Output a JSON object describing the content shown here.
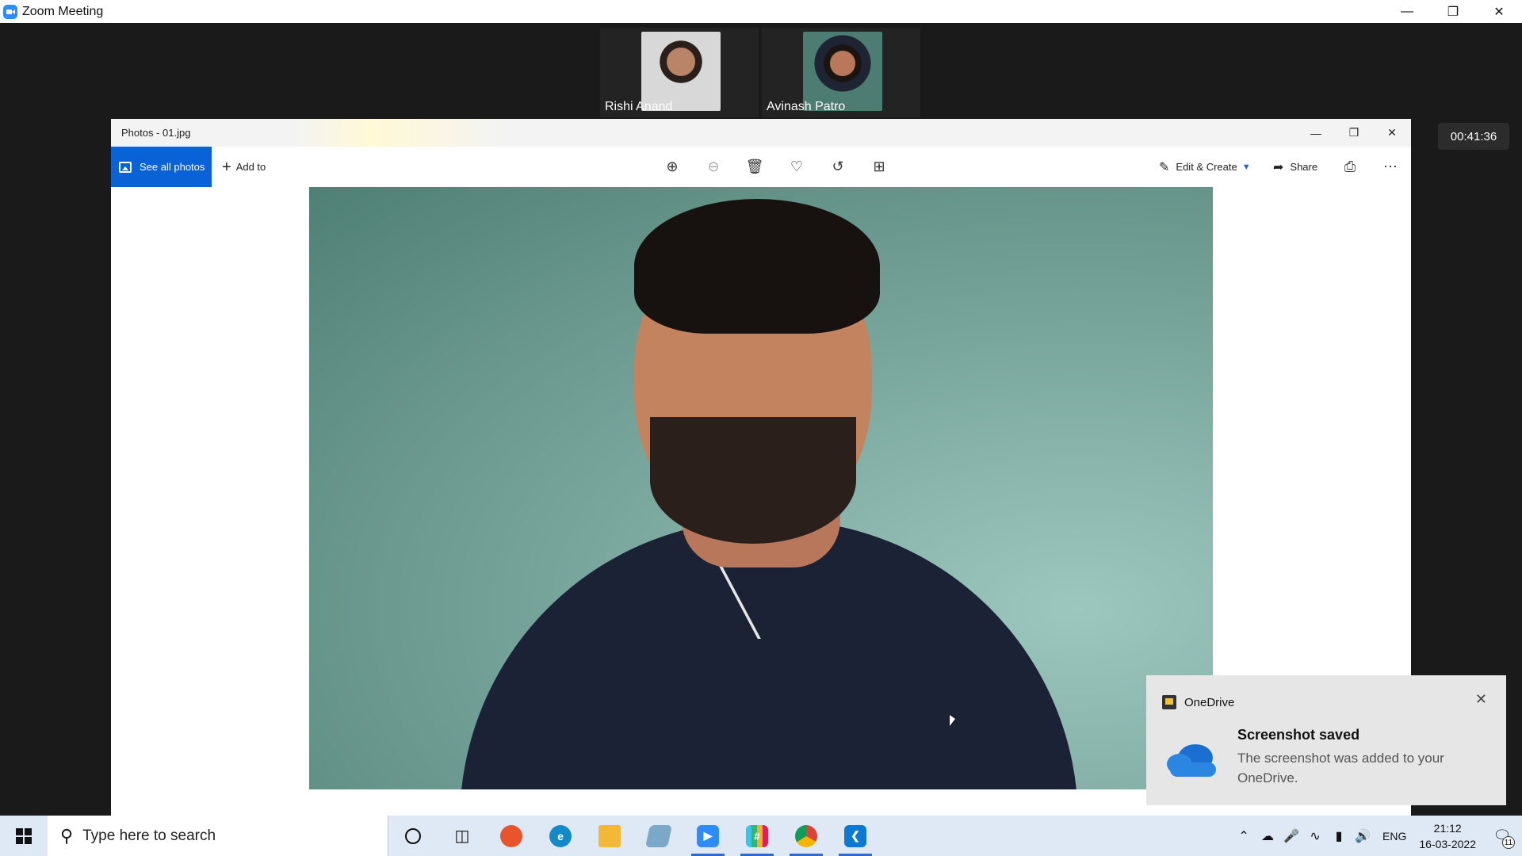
{
  "zoom": {
    "title": "Zoom Meeting",
    "timer": "00:41:36",
    "participants": [
      {
        "name": "Rishi Anand"
      },
      {
        "name": "Avinash Patro"
      }
    ]
  },
  "photos": {
    "title": "Photos - 01.jpg",
    "toolbar": {
      "see_all": "See all photos",
      "add_to": "Add to",
      "edit_create": "Edit & Create",
      "share": "Share"
    }
  },
  "toast": {
    "app": "OneDrive",
    "heading": "Screenshot saved",
    "body": "The screenshot was added to your OneDrive."
  },
  "taskbar": {
    "search_placeholder": "Type here to search",
    "lang": "ENG",
    "time": "21:12",
    "date": "16-03-2022",
    "notification_count": "11"
  },
  "colors": {
    "accent": "#0a63d6",
    "zoom_blue": "#2d8cff",
    "photo_bg": "#7aa79d"
  }
}
